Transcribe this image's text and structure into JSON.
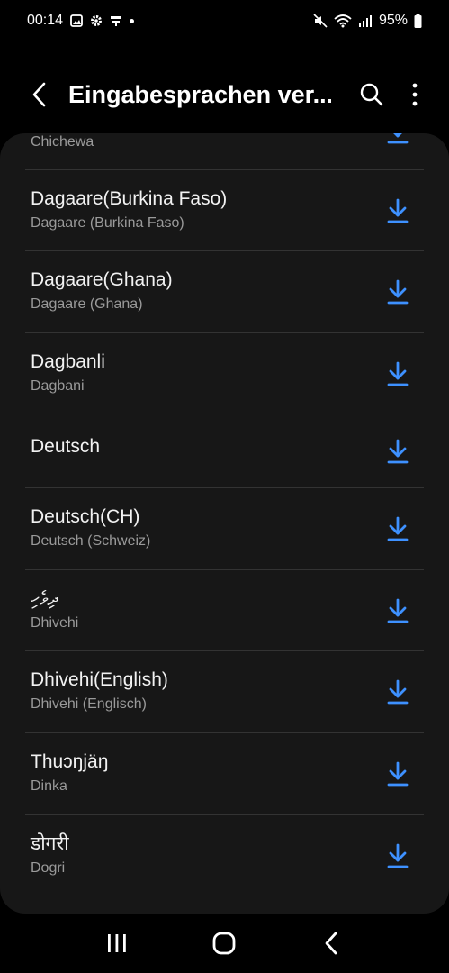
{
  "status_bar": {
    "time": "00:14",
    "battery": "95%",
    "icons_left": [
      "gallery-icon",
      "settings-icon",
      "notification-icon",
      "dot"
    ],
    "icons_right": [
      "mute-icon",
      "wifi-icon",
      "signal-icon",
      "battery-icon"
    ]
  },
  "header": {
    "title": "Eingabesprachen ver..."
  },
  "colors": {
    "background": "#000000",
    "card": "#171717",
    "accent": "#3e91ff",
    "secondary_text": "#9a9a9a"
  },
  "list": {
    "items": [
      {
        "name": "",
        "sub": "Chichewa"
      },
      {
        "name": "Dagaare(Burkina Faso)",
        "sub": "Dagaare (Burkina Faso)"
      },
      {
        "name": "Dagaare(Ghana)",
        "sub": "Dagaare (Ghana)"
      },
      {
        "name": "Dagbanli",
        "sub": "Dagbani"
      },
      {
        "name": "Deutsch",
        "sub": ""
      },
      {
        "name": "Deutsch(CH)",
        "sub": "Deutsch (Schweiz)"
      },
      {
        "name": "ދިވެހި",
        "sub": "Dhivehi"
      },
      {
        "name": "Dhivehi(English)",
        "sub": "Dhivehi (Englisch)"
      },
      {
        "name": "Thuɔŋjäŋ",
        "sub": "Dinka"
      },
      {
        "name": "डोगरी",
        "sub": "Dogri"
      }
    ]
  }
}
